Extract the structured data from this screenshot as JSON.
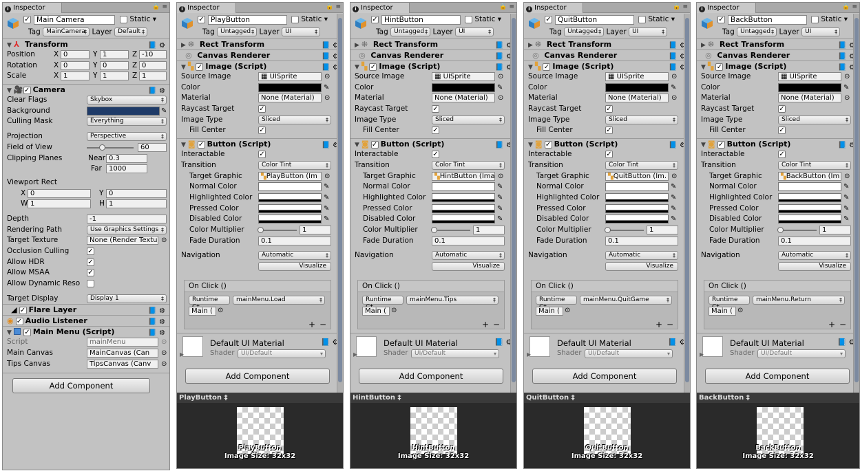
{
  "left": {
    "tab_label": "Inspector",
    "object_name": "Main Camera",
    "static_label": "Static",
    "tag_label": "Tag",
    "tag_value": "MainCamera",
    "layer_label": "Layer",
    "layer_value": "Default",
    "transform": {
      "title": "Transform",
      "rows": [
        {
          "label": "Position",
          "x": "0",
          "y": "1",
          "z": "-10"
        },
        {
          "label": "Rotation",
          "x": "0",
          "y": "0",
          "z": "0"
        },
        {
          "label": "Scale",
          "x": "1",
          "y": "1",
          "z": "1"
        }
      ]
    },
    "camera": {
      "title": "Camera",
      "clear_flags_label": "Clear Flags",
      "clear_flags": "Skybox",
      "background_label": "Background",
      "background_color": "#1f3b68",
      "culling_label": "Culling Mask",
      "culling": "Everything",
      "projection_label": "Projection",
      "projection": "Perspective",
      "fov_label": "Field of View",
      "fov": "60",
      "clipping_label": "Clipping Planes",
      "near_label": "Near",
      "near": "0.3",
      "far_label": "Far",
      "far": "1000",
      "viewport_label": "Viewport Rect",
      "vx": "0",
      "vy": "0",
      "vw": "1",
      "vh": "1",
      "depth_label": "Depth",
      "depth": "-1",
      "render_path_label": "Rendering Path",
      "render_path": "Use Graphics Settings",
      "target_tex_label": "Target Texture",
      "target_tex": "None (Render Textu",
      "occlusion_label": "Occlusion Culling",
      "hdr_label": "Allow HDR",
      "msaa_label": "Allow MSAA",
      "dynres_label": "Allow Dynamic Reso",
      "display_label": "Target Display",
      "display": "Display 1"
    },
    "flare_title": "Flare Layer",
    "listener_title": "Audio Listener",
    "mainmenu": {
      "title": "Main Menu (Script)",
      "script_label": "Script",
      "script": "mainMenu",
      "main_canvas_label": "Main Canvas",
      "main_canvas": "MainCanvas (Can",
      "tips_canvas_label": "Tips Canvas",
      "tips_canvas": "TipsCanvas (Canv"
    },
    "add_component": "Add Component"
  },
  "common": {
    "tab_label": "Inspector",
    "static_label": "Static",
    "tag_label": "Tag",
    "tag_value": "Untagged",
    "layer_label": "Layer",
    "layer_value": "UI",
    "rect_transform": "Rect Transform",
    "canvas_renderer": "Canvas Renderer",
    "image_title": "Image (Script)",
    "source_image_label": "Source Image",
    "source_image": "UISprite",
    "color_label": "Color",
    "material_label": "Material",
    "material": "None (Material)",
    "raycast_label": "Raycast Target",
    "image_type_label": "Image Type",
    "image_type": "Sliced",
    "fill_center_label": "Fill Center",
    "button_title": "Button (Script)",
    "interactable_label": "Interactable",
    "transition_label": "Transition",
    "transition": "Color Tint",
    "target_graphic_label": "Target Graphic",
    "normal_label": "Normal Color",
    "highlighted_label": "Highlighted Color",
    "pressed_label": "Pressed Color",
    "disabled_label": "Disabled Color",
    "multiplier_label": "Color Multiplier",
    "multiplier": "1",
    "fade_label": "Fade Duration",
    "fade": "0.1",
    "navigation_label": "Navigation",
    "navigation": "Automatic",
    "visualize": "Visualize",
    "onclick_label": "On Click ()",
    "runtime": "Runtime C‡",
    "main_obj": "Main (",
    "plus": "+",
    "minus": "−",
    "material_name": "Default UI Material",
    "shader_label": "Shader",
    "shader": "UI/Default",
    "add_component": "Add Component",
    "image_size": "Image Size: 32x32"
  },
  "panels": [
    {
      "name": "PlayButton",
      "target": "PlayButton (Im",
      "function": "mainMenu.Load"
    },
    {
      "name": "HintButton",
      "target": "HintButton (Ima",
      "function": "mainMenu.Tips"
    },
    {
      "name": "QuitButton",
      "target": "QuitButton (Im.",
      "function": "mainMenu.QuitGame"
    },
    {
      "name": "BackButton",
      "target": "BackButton (Im",
      "function": "mainMenu.Return"
    }
  ]
}
